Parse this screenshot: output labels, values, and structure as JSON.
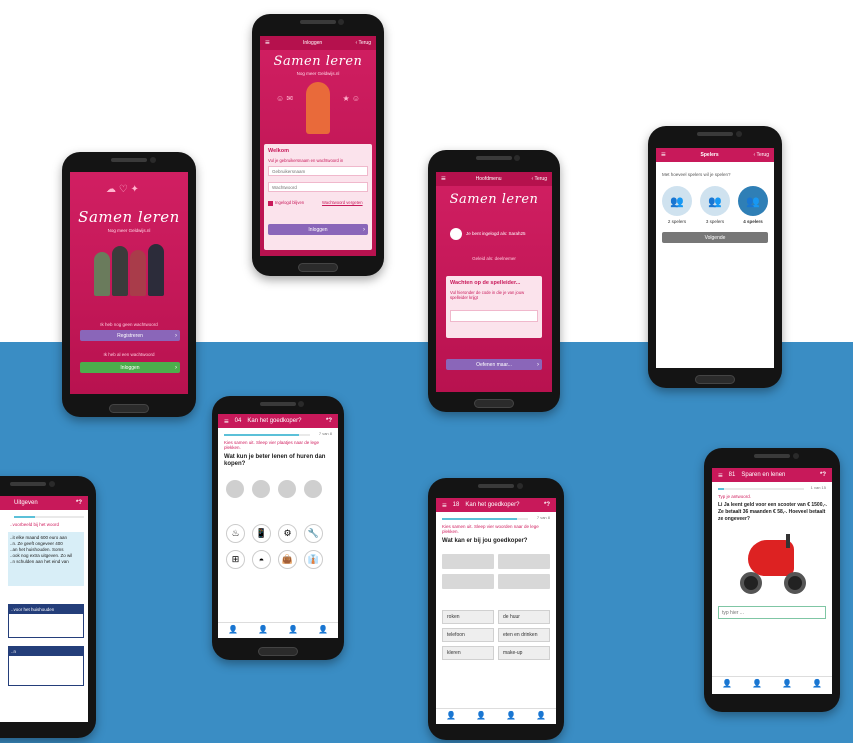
{
  "colors": {
    "brand_pink": "#c8195a",
    "ocean_blue": "#3a8dc4",
    "login_green": "#4cae4c",
    "register_purple": "#8a66b9",
    "phone_black": "#141414"
  },
  "icons": {
    "menu": "hamburger-icon",
    "back": "chevron-left-icon",
    "help": "question-icon",
    "next": "chevron-right-icon",
    "user": "user-icon"
  },
  "phone1": {
    "logo": "Samen leren",
    "tagline": "Nog meer Geldwijs.nl",
    "no_account_text": "Ik heb nog geen wachtwoord",
    "register_label": "Registreren",
    "have_account_text": "Ik heb al een wachtwoord",
    "login_label": "Inloggen"
  },
  "phone2": {
    "topbar_title": "Inloggen",
    "back_label": "Terug",
    "logo": "Samen leren",
    "tagline": "Nog meer Geldwijs.nl",
    "welcome": "Welkom",
    "intro": "Vul je gebruikersnaam en wachtwoord in",
    "username_placeholder": "Gebruikersnaam",
    "password_placeholder": "Wachtwoord",
    "remember_label": "Ingelogd blijven",
    "forgot_label": "Wachtwoord vergeten",
    "submit_label": "Inloggen"
  },
  "phone3": {
    "topbar_title": "Hoofdmenu",
    "back_label": "Terug",
    "logo": "Samen leren",
    "logged_in_as": "Je bent ingelogd als: Sarah25",
    "role_text": "Geleid als: deelnemer",
    "wait_title": "Wachten op de spelleider...",
    "wait_body": "Vul hieronder de code in die je van jouw spelleider krijgt",
    "practice_label": "Oefenen maar..."
  },
  "phone4": {
    "topbar_title": "Spelers",
    "back_label": "Terug",
    "question": "Met hoeveel spelers wil je spelen?",
    "options": [
      "2 spelers",
      "3 spelers",
      "4 spelers"
    ],
    "selected": 2,
    "next_label": "Volgende"
  },
  "phone5": {
    "number": "04",
    "title": "Kan het goedkoper?",
    "progress_label": "7 van 8",
    "progress": 0.875,
    "instruction": "Kies samen uit. Sleep vier plaatjes naar de lege plekken.",
    "question": "Wat kun je beter lenen of huren dan kopen?",
    "items": [
      "strijkijzer-icon",
      "telefoon-icon",
      "schuurmachine-icon",
      "boormachine-icon",
      "ladder-icon",
      "fietshelm-icon",
      "fietstas-icon",
      "colbert-icon"
    ]
  },
  "phone6": {
    "number": "18",
    "title": "Kan het goedkoper?",
    "progress_label": "7 van 8",
    "progress": 0.875,
    "instruction": "Kies samen uit. Sleep vier woorden naar de lege plekken.",
    "question": "Wat kan er bij jou goedkoper?",
    "words": [
      "roken",
      "de huur",
      "telefoon",
      "eten en drinken",
      "kleren",
      "make-up"
    ]
  },
  "phone7": {
    "number": "81",
    "title": "Sparen en lenen",
    "progress_label": "1 van 15",
    "progress": 0.07,
    "instruction": "Typ je antwoord.",
    "question": "Li Ja leent geld voor een scooter van € 1500,-. Ze betaalt 36 maanden € 58,-. Hoeveel betaalt ze ongeveer?",
    "answer_placeholder": "typ hier ..."
  },
  "phone8": {
    "title": "Uitgeven",
    "lines": [
      "..it elke maand 600 euro aan",
      "..n. Ze geeft ongeveer 400",
      "..an het huishouden. Soms",
      "..ook nog extra uitgeven. Zo wil",
      "..n schulden aan het eind van"
    ],
    "heading": "..voorbeeld bij het woord",
    "card_text": "..voor het huishouden",
    "card_text2": "..n"
  }
}
